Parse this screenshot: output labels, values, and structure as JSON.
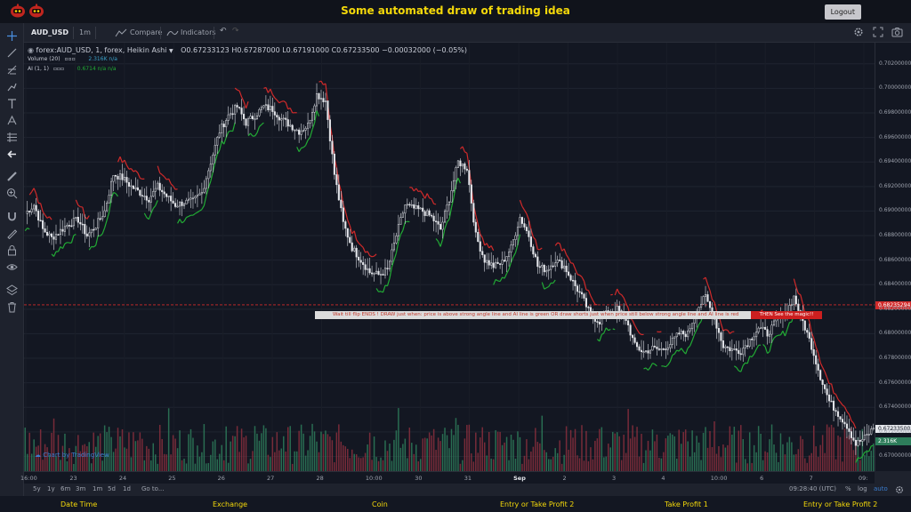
{
  "app": {
    "title": "Some automated draw of trading idea",
    "logout_label": "Logout",
    "icon_names": [
      "robot-icon",
      "robot-icon"
    ]
  },
  "toolbar": {
    "symbol": "AUD_USD",
    "interval": "1m",
    "compare_label": "Compare",
    "indicators_label": "Indicators"
  },
  "legend": {
    "main": "forex:AUD_USD, 1, forex, Heikin Ashi",
    "ohlc": "O0.67233123  H0.67287000  L0.67191000  C0.67233500  −0.00032000 (−0.05%)",
    "volume_label": "Volume (20)",
    "volume_value": "2.316K  n/a",
    "ai_label": "AI (1, 1)",
    "ai_value": "0.6714  n/a  n/a"
  },
  "watermark": "Chart by TradingView",
  "banner": {
    "text": "Wait till flip ENDS  !    DRAW just when:  price is above strong angle line and AI line is green          OR         draw shorts just when price still below strong angle line and AI line is red",
    "tag": "THEN See the magic!!"
  },
  "price_axis": {
    "ticks": [
      "0.70200000",
      "0.70000000",
      "0.69800000",
      "0.69600000",
      "0.69400000",
      "0.69200000",
      "0.69000000",
      "0.68800000",
      "0.68600000",
      "0.68400000",
      "0.68200000",
      "0.68000000",
      "0.67800000",
      "0.67600000",
      "0.67400000",
      "0.67200000",
      "0.67000000"
    ],
    "line_tag": "0.68235294",
    "last_tag": "0.67233500",
    "vol_tag": "2.316K"
  },
  "time_axis": {
    "labels": [
      "16:00",
      "23",
      "24",
      "25",
      "26",
      "27",
      "28",
      "10:00",
      "30",
      "31",
      "Sep",
      "2",
      "3",
      "4",
      "10:00",
      "6",
      "7",
      "09:"
    ]
  },
  "bottombar": {
    "ranges": [
      "5y",
      "1y",
      "6m",
      "3m",
      "1m",
      "5d",
      "1d"
    ],
    "goto": "Go to...",
    "clock": "09:28:40 (UTC)",
    "pct": "%",
    "log": "log",
    "auto": "auto"
  },
  "footer": [
    "Date Time",
    "Exchange",
    "Coin",
    "Entry or Take Profit 2",
    "Take Profit 1",
    "Entry or Take Profit 2"
  ],
  "colors": {
    "background": "#131722",
    "panel": "#1e222d",
    "title": "#f5d90a",
    "ai_green": "#22ab35",
    "ai_red": "#d12a2a",
    "vol_green": "#2e7d5b",
    "vol_red": "#8b2f3d"
  },
  "chart_data": {
    "type": "candlestick",
    "title": "",
    "series_name": "forex:AUD_USD",
    "ylim": [
      0.6688,
      0.703
    ],
    "hline": 0.68235294,
    "close_path": [
      0.6898,
      0.6905,
      0.6885,
      0.6878,
      0.6884,
      0.689,
      0.6893,
      0.688,
      0.6888,
      0.69,
      0.693,
      0.6927,
      0.692,
      0.6915,
      0.691,
      0.692,
      0.6912,
      0.6905,
      0.6907,
      0.6908,
      0.6915,
      0.694,
      0.6965,
      0.6978,
      0.6985,
      0.6972,
      0.6978,
      0.6985,
      0.6983,
      0.6975,
      0.697,
      0.6965,
      0.697,
      0.6995,
      0.699,
      0.693,
      0.689,
      0.687,
      0.686,
      0.685,
      0.6848,
      0.6852,
      0.688,
      0.6905,
      0.6902,
      0.69,
      0.6895,
      0.6885,
      0.691,
      0.694,
      0.6935,
      0.688,
      0.686,
      0.6855,
      0.6858,
      0.687,
      0.6895,
      0.688,
      0.6855,
      0.6852,
      0.686,
      0.6855,
      0.6842,
      0.683,
      0.6815,
      0.681,
      0.6818,
      0.682,
      0.6812,
      0.679,
      0.6785,
      0.6788,
      0.6787,
      0.6792,
      0.68,
      0.68,
      0.682,
      0.683,
      0.6812,
      0.679,
      0.6787,
      0.6786,
      0.6795,
      0.6805,
      0.68,
      0.681,
      0.6815,
      0.683,
      0.681,
      0.679,
      0.6765,
      0.6745,
      0.6735,
      0.6725,
      0.671,
      0.6715,
      0.6723
    ]
  }
}
